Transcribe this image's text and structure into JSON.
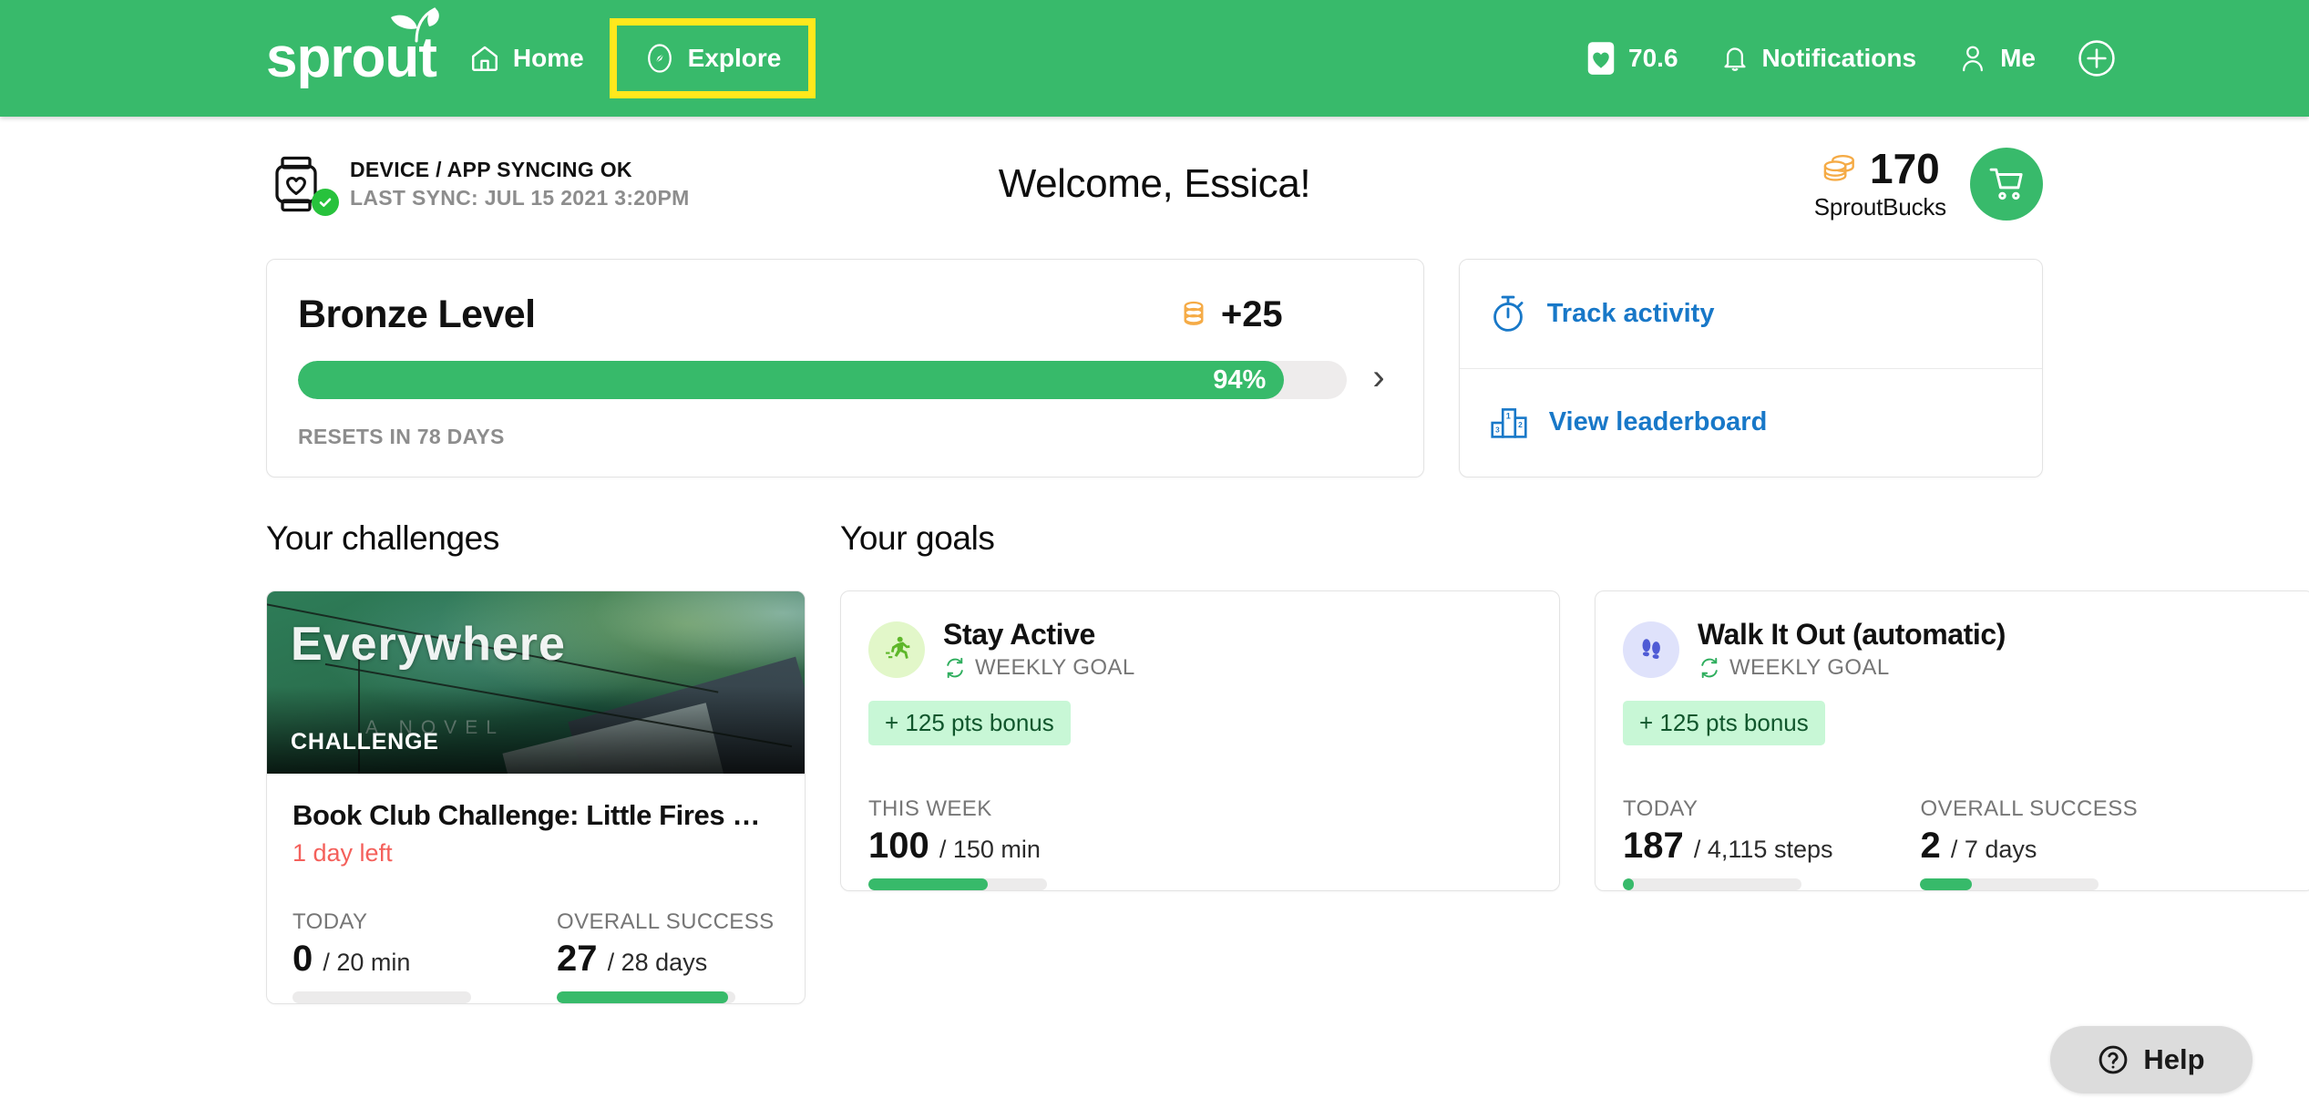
{
  "header": {
    "logo_text": "sprout",
    "nav": [
      {
        "label": "Home",
        "icon": "home-icon"
      },
      {
        "label": "Explore",
        "icon": "compass-icon",
        "highlighted": true
      }
    ],
    "score": "70.6",
    "notifications_label": "Notifications",
    "me_label": "Me",
    "add_label": "+",
    "brand_green": "#38ba6b",
    "highlight_yellow": "#ffe81c"
  },
  "status": {
    "sync_status": "DEVICE / APP SYNCING OK",
    "last_sync": "LAST SYNC: JUL 15 2021 3:20PM",
    "welcome": "Welcome, Essica!",
    "bucks_value": "170",
    "bucks_label": "SproutBucks"
  },
  "level_card": {
    "title": "Bronze Level",
    "bonus": "+25",
    "progress_label": "94%",
    "progress_pct": 94,
    "resets": "RESETS IN 78 DAYS"
  },
  "quick_links": [
    {
      "label": "Track activity",
      "icon": "stopwatch-icon"
    },
    {
      "label": "View leaderboard",
      "icon": "podium-icon"
    }
  ],
  "challenges": {
    "section_title": "Your challenges",
    "card": {
      "cover_title": "Everywhere",
      "cover_subtitle": "A NOVEL",
      "tag": "CHALLENGE",
      "name": "Book Club Challenge: Little Fires …",
      "time_left": "1 day left",
      "stats": [
        {
          "label": "TODAY",
          "value": "0",
          "denom": "/ 20 min",
          "pct": 0
        },
        {
          "label": "OVERALL SUCCESS",
          "value": "27",
          "denom": "/ 28 days",
          "pct": 96
        }
      ]
    }
  },
  "goals": {
    "section_title": "Your goals",
    "cards": [
      {
        "name": "Stay Active",
        "kind": "WEEKLY GOAL",
        "icon": "runner-icon",
        "avatar_bg": "#e2f7c9",
        "bonus": "+ 125 pts bonus",
        "stats": [
          {
            "label": "THIS WEEK",
            "value": "100",
            "denom": "/ 150 min",
            "pct": 67
          }
        ]
      },
      {
        "name": "Walk It Out (automatic)",
        "kind": "WEEKLY GOAL",
        "icon": "footprints-icon",
        "avatar_bg": "#dfe2fb",
        "bonus": "+ 125 pts bonus",
        "stats": [
          {
            "label": "TODAY",
            "value": "187",
            "denom": "/ 4,115 steps",
            "pct": 5
          },
          {
            "label": "OVERALL SUCCESS",
            "value": "2",
            "denom": "/ 7 days",
            "pct": 29
          }
        ]
      }
    ]
  },
  "help": {
    "label": "Help"
  }
}
